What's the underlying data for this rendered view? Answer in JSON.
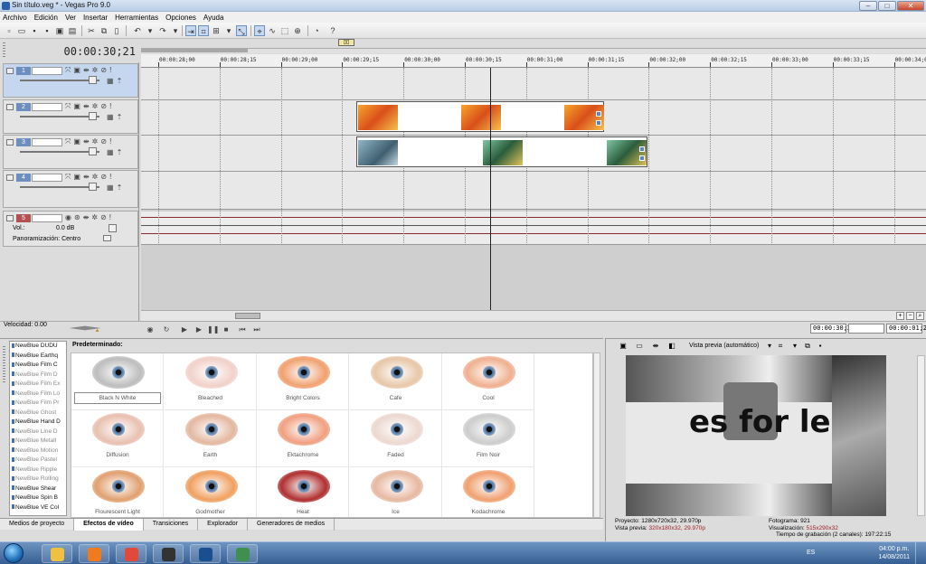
{
  "window": {
    "title": "Sin título.veg * - Vegas Pro 9.0",
    "minimize": "–",
    "maximize": "□",
    "close": "✕"
  },
  "menu": [
    "Archivo",
    "Edición",
    "Ver",
    "Insertar",
    "Herramientas",
    "Opciones",
    "Ayuda"
  ],
  "toolbar_icons": [
    "new-icon",
    "open-icon",
    "save-icon",
    "save-as-icon",
    "render-icon",
    "properties-icon",
    "cut-icon",
    "copy-icon",
    "paste-icon",
    "delete-icon",
    "undo-icon",
    "redo-icon",
    "auto-ripple-icon",
    "snap-icon",
    "lock-envelopes-icon",
    "normal-edit-tool-icon",
    "envelope-tool-icon",
    "zoom-tool-icon",
    "enable-snapping-icon",
    "capture-icon",
    "help-icon"
  ],
  "timeline": {
    "current_time": "00:00:30;21",
    "ruler_labels": [
      "00:00:28;00",
      "00:00:28;15",
      "00:00:29;00",
      "00:00:29;15",
      "00:00:30;00",
      "00:00:30;15",
      "00:00:31;00",
      "00:00:31;15",
      "00:00:32;00",
      "00:00:32;15",
      "00:00:33;00",
      "00:00:33;15",
      "00:00:34;00"
    ],
    "tracks": [
      {
        "number": "1",
        "type": "video",
        "selected": true
      },
      {
        "number": "2",
        "type": "video",
        "selected": false
      },
      {
        "number": "3",
        "type": "video",
        "selected": false
      },
      {
        "number": "4",
        "type": "video",
        "selected": false
      },
      {
        "number": "5",
        "type": "audio",
        "selected": false
      }
    ],
    "audio_track": {
      "vol_label": "Vol.:",
      "vol_value": "0.0 dB",
      "pan_label": "Panoramización: Centro"
    }
  },
  "transport": {
    "speed": "Velocidad: 0.00",
    "position": "00:00:30;21",
    "end_time": "00:00:01;26"
  },
  "effects_panel": {
    "plugins": [
      "NewBlue DUDU",
      "NewBlue Earthq",
      "NewBlue Film C",
      "NewBlue Film D",
      "NewBlue Film Ex",
      "NewBlue Film Lo",
      "NewBlue Film Pr",
      "NewBlue Ghost",
      "NewBlue Hand D",
      "NewBlue Line D",
      "NewBlue Metall",
      "NewBlue Motion",
      "NewBlue Pastel",
      "NewBlue Ripple",
      "NewBlue Rolling",
      "NewBlue Shear",
      "NewBlue Spin B",
      "NewBlue VE Col"
    ],
    "presets_label": "Predeterminado:",
    "presets": [
      {
        "label": "Black N White",
        "tint": "#bdbdbd"
      },
      {
        "label": "Bleached",
        "tint": "#f1d1c9"
      },
      {
        "label": "Bright Colors",
        "tint": "#f0a070"
      },
      {
        "label": "Cafe",
        "tint": "#e7c7a7"
      },
      {
        "label": "Cool",
        "tint": "#f0b090"
      },
      {
        "label": "Diffusion",
        "tint": "#e9c0b0"
      },
      {
        "label": "Earth",
        "tint": "#e4b8a0"
      },
      {
        "label": "Ektachrome",
        "tint": "#f0a080"
      },
      {
        "label": "Faded",
        "tint": "#ecd8d0"
      },
      {
        "label": "Film Noir",
        "tint": "#cccccc"
      },
      {
        "label": "Flourescent Light",
        "tint": "#e0a070"
      },
      {
        "label": "Godmother",
        "tint": "#f0a060"
      },
      {
        "label": "Heat",
        "tint": "#b03030"
      },
      {
        "label": "Ice",
        "tint": "#e7b8a0"
      },
      {
        "label": "Kodachrome",
        "tint": "#f0a070"
      }
    ]
  },
  "bottom_tabs": [
    "Medios de proyecto",
    "Efectos de vídeo",
    "Transiciones",
    "Explorador",
    "Generadores de medios"
  ],
  "preview": {
    "mode": "Vista previa (automático)",
    "overlay_text": "es for less!",
    "info": [
      {
        "label": "Proyecto:",
        "value": "1280x720x32, 29.970p"
      },
      {
        "label": "Vista previa:",
        "value": "320x180x32, 29.970p"
      }
    ],
    "info2": [
      {
        "label": "Fotograma:",
        "value": "921"
      },
      {
        "label": "Visualización:",
        "value": "515x290x32"
      }
    ]
  },
  "record_time": "Tiempo de grabación (2 canales): 197:22:15",
  "taskbar": {
    "language": "ES",
    "time": "04:00 p.m.",
    "date": "14/08/2011",
    "apps": [
      {
        "name": "explorer-icon",
        "color": "#f0c040"
      },
      {
        "name": "media-player-icon",
        "color": "#f07a20"
      },
      {
        "name": "chrome-icon",
        "color": "#e04a3a"
      },
      {
        "name": "vegas-icon",
        "color": "#333333"
      },
      {
        "name": "photoshop-icon",
        "color": "#1a4f8f"
      },
      {
        "name": "monitor-icon",
        "color": "#3f8f4f"
      }
    ]
  }
}
